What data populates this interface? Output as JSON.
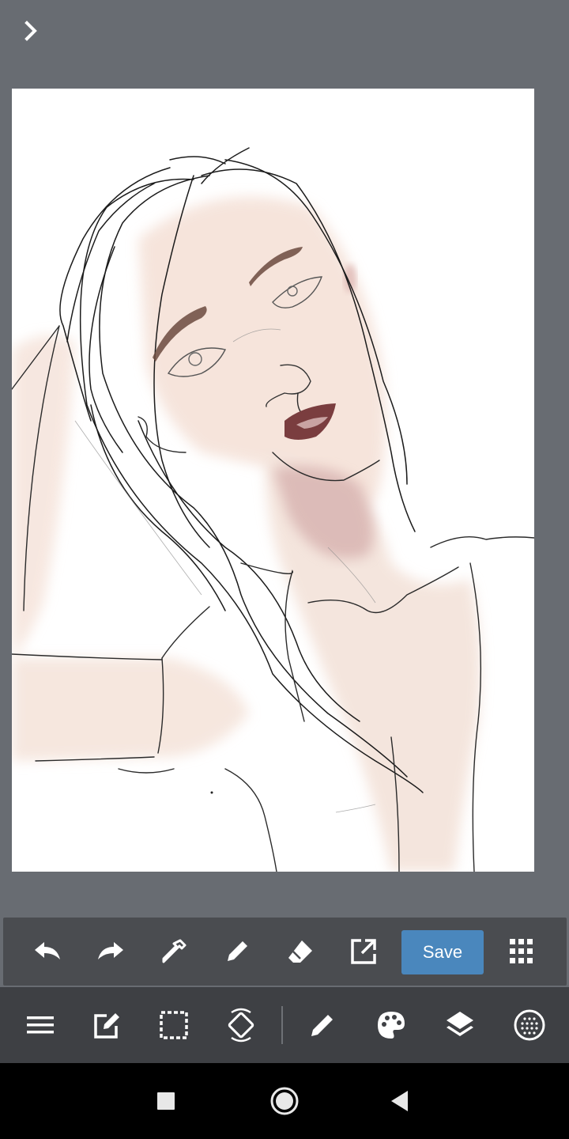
{
  "app": {
    "background_color": "#686c72",
    "accent_color": "#4a87bd"
  },
  "top": {
    "expand_icon": "chevron-right-icon"
  },
  "toolbar": {
    "undo_icon": "undo-icon",
    "redo_icon": "redo-icon",
    "eyedropper_icon": "eyedropper-icon",
    "pen_icon": "pen-icon",
    "eraser_icon": "eraser-icon",
    "export_icon": "external-link-icon",
    "save_label": "Save",
    "more_icon": "grid-dots-icon"
  },
  "bottom_toolbar": {
    "items": [
      {
        "icon": "menu-icon"
      },
      {
        "icon": "edit-icon"
      },
      {
        "icon": "selection-icon"
      },
      {
        "icon": "rotate-canvas-icon"
      },
      {
        "icon": "brush-icon"
      },
      {
        "icon": "palette-icon"
      },
      {
        "icon": "layers-icon"
      },
      {
        "icon": "material-icon"
      }
    ]
  },
  "nav": {
    "items": [
      {
        "icon": "recents-square-icon"
      },
      {
        "icon": "home-circle-icon"
      },
      {
        "icon": "back-triangle-icon"
      }
    ]
  }
}
